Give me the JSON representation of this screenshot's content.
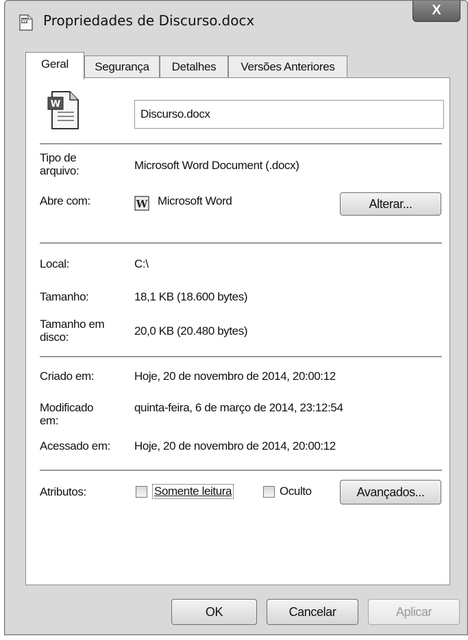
{
  "window": {
    "title": "Propriedades de Discurso.docx",
    "close_symbol": "X"
  },
  "tabs": [
    {
      "label": "Geral",
      "active": true
    },
    {
      "label": "Segurança",
      "active": false
    },
    {
      "label": "Detalhes",
      "active": false
    },
    {
      "label": "Versões Anteriores",
      "active": false
    }
  ],
  "file": {
    "name": "Discurso.docx",
    "icon": "word-document-icon"
  },
  "props": {
    "type_label": "Tipo de\narquivo:",
    "type_value": "Microsoft Word Document (.docx)",
    "opens_label": "Abre com:",
    "opens_icon_letter": "W",
    "opens_value": "Microsoft Word",
    "change_button": "Alterar...",
    "location_label": "Local:",
    "location_value": "C:\\",
    "size_label": "Tamanho:",
    "size_value": "18,1 KB (18.600 bytes)",
    "disk_size_label": "Tamanho em\ndisco:",
    "disk_size_value": "20,0 KB (20.480 bytes)",
    "created_label": "Criado em:",
    "created_value": "Hoje, 20 de novembro de 2014, 20:00:12",
    "modified_label": "Modificado\nem:",
    "modified_value": "quinta-feira, 6 de março de 2014, 23:12:54",
    "accessed_label": "Acessado em:",
    "accessed_value": "Hoje, 20 de novembro de 2014, 20:00:12"
  },
  "attributes": {
    "label": "Atributos:",
    "readonly_label": "Somente leitura",
    "readonly_checked": false,
    "hidden_label": "Oculto",
    "hidden_checked": false,
    "advanced_button": "Avançados..."
  },
  "footer": {
    "ok": "OK",
    "cancel": "Cancelar",
    "apply": "Aplicar",
    "apply_enabled": false
  }
}
